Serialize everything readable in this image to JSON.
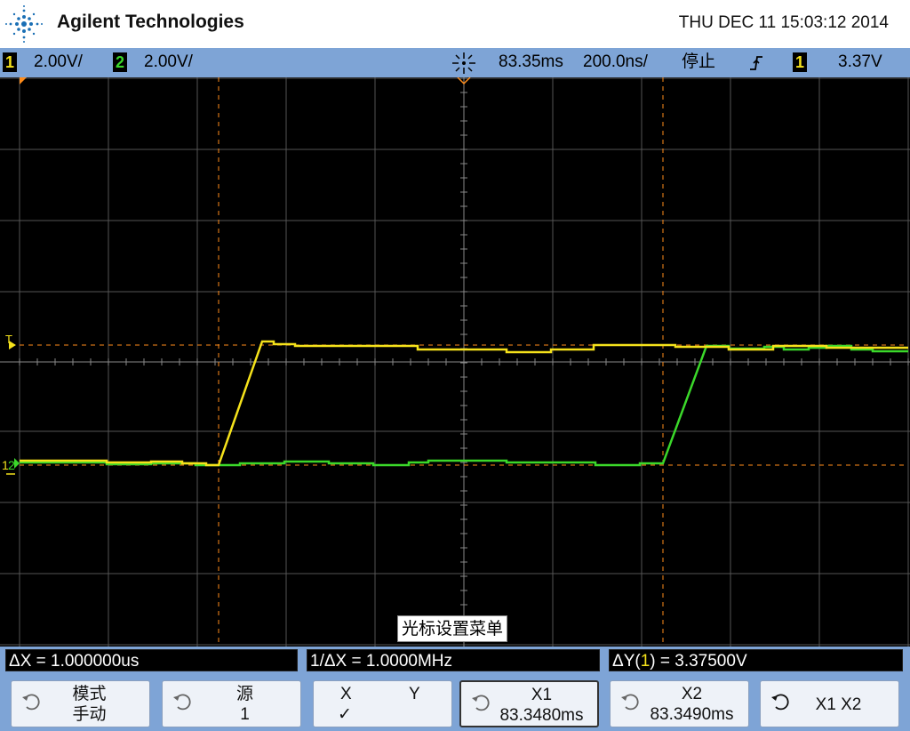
{
  "header": {
    "brand": "Agilent Technologies",
    "datetime": "THU DEC 11 15:03:12 2014"
  },
  "status": {
    "ch1_num": "1",
    "ch1_scale": "2.00V/",
    "ch2_num": "2",
    "ch2_scale": "2.00V/",
    "time_delay": "83.35ms",
    "time_scale": "200.0ns/",
    "run_state": "停止",
    "trigger_edge": "rising-edge-icon",
    "trigger_source": "1",
    "trigger_level": "3.37V"
  },
  "screen": {
    "trigger_marker": "T",
    "ch1_marker": "1",
    "ch2_marker": "2",
    "menu_title": "光标设置菜单",
    "colors": {
      "ch1": "#f5e21b",
      "ch2": "#3bd82a",
      "cursor": "#ff8c1a",
      "grid": "#5a5a5a"
    }
  },
  "measurements": {
    "delta_x": "ΔX = 1.000000us",
    "inv_delta_x": "1/ΔX = 1.0000MHz",
    "delta_y_prefix": "ΔY(",
    "delta_y_src": "1",
    "delta_y_suffix": ") = 3.37500V"
  },
  "softkeys": {
    "mode_l1": "模式",
    "mode_l2": "手动",
    "source_l1": "源",
    "source_l2": "1",
    "xy_x": "X",
    "xy_y": "Y",
    "xy_check": "✓",
    "x1_l1": "X1",
    "x1_l2": "83.3480ms",
    "x2_l1": "X2",
    "x2_l2": "83.3490ms",
    "x1x2_label": "X1 X2"
  }
}
